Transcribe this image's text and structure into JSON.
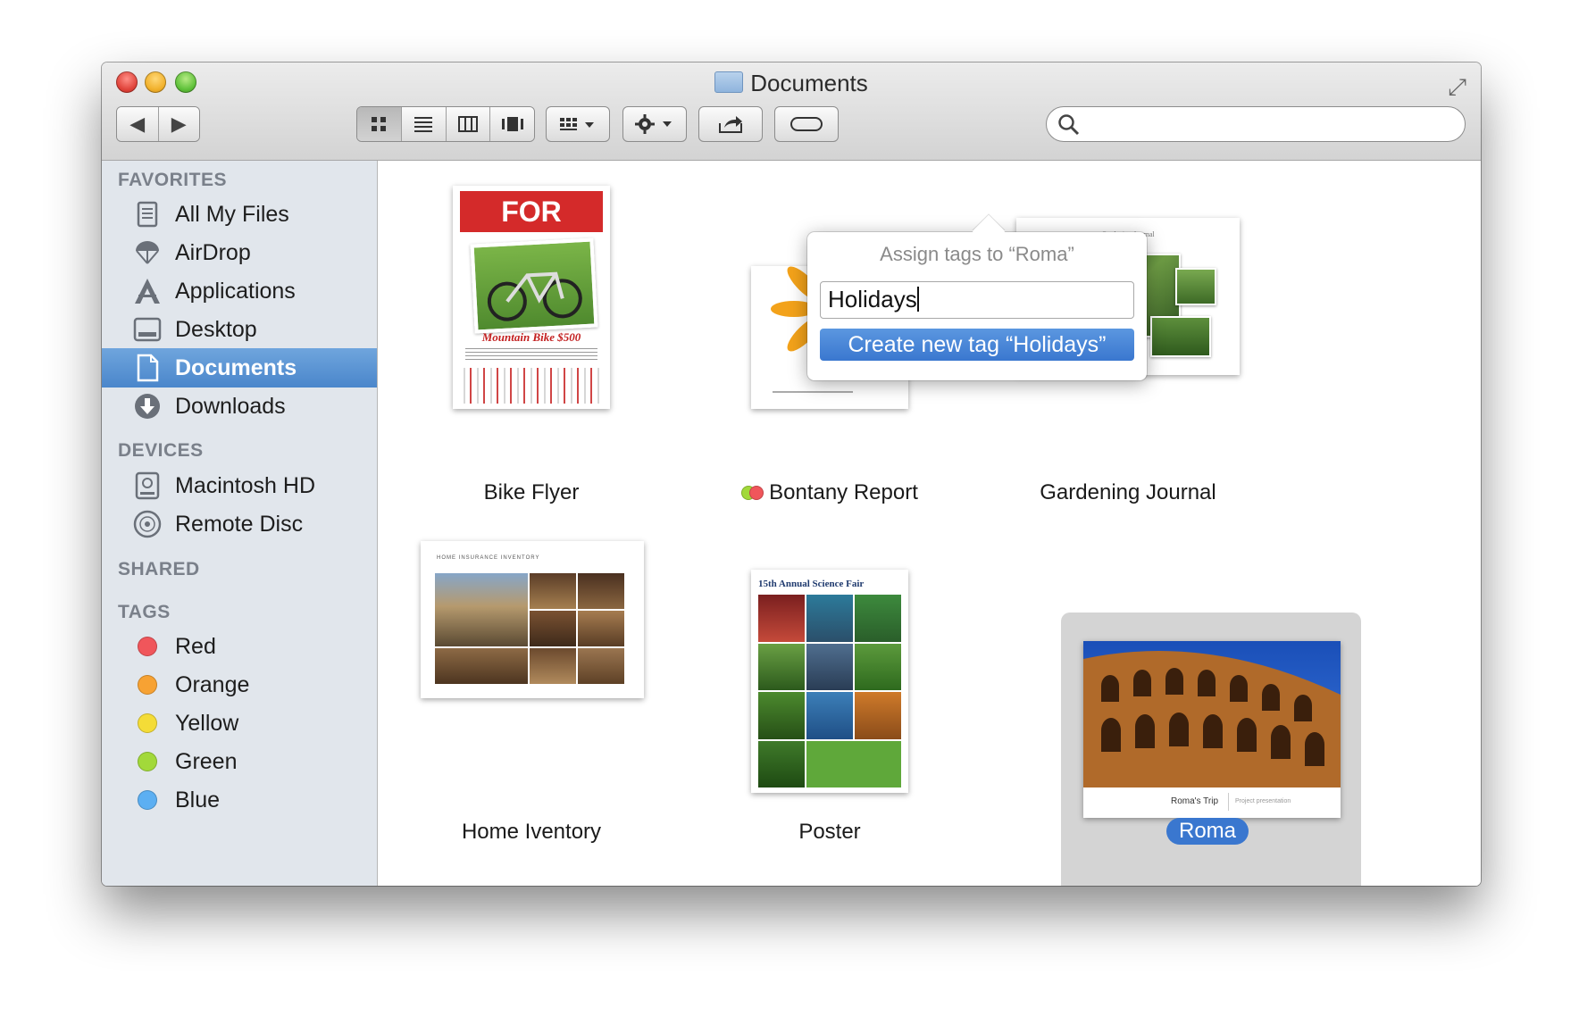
{
  "window": {
    "title": "Documents"
  },
  "toolbar": {
    "back_icon": "chevron-left-icon",
    "forward_icon": "chevron-right-icon",
    "view_icons": [
      "icon-view-icon",
      "list-view-icon",
      "column-view-icon",
      "coverflow-view-icon"
    ],
    "arrange_icon": "arrange-grid-icon",
    "action_icon": "gear-icon",
    "share_icon": "share-icon",
    "tags_icon": "tag-pill-icon",
    "search": {
      "value": "",
      "placeholder": ""
    }
  },
  "sidebar": {
    "favorites_header": "FAVORITES",
    "favorites": [
      {
        "label": "All My Files",
        "icon": "all-files-icon"
      },
      {
        "label": "AirDrop",
        "icon": "airdrop-icon"
      },
      {
        "label": "Applications",
        "icon": "applications-icon"
      },
      {
        "label": "Desktop",
        "icon": "desktop-icon"
      },
      {
        "label": "Documents",
        "icon": "documents-icon",
        "selected": true
      },
      {
        "label": "Downloads",
        "icon": "downloads-icon"
      }
    ],
    "devices_header": "DEVICES",
    "devices": [
      {
        "label": "Macintosh HD",
        "icon": "hard-drive-icon"
      },
      {
        "label": "Remote Disc",
        "icon": "disc-icon"
      }
    ],
    "shared_header": "SHARED",
    "tags_header": "TAGS",
    "tags": [
      {
        "label": "Red",
        "color": "#f0565b"
      },
      {
        "label": "Orange",
        "color": "#f7a233"
      },
      {
        "label": "Yellow",
        "color": "#f4dc37"
      },
      {
        "label": "Green",
        "color": "#a2d93a"
      },
      {
        "label": "Blue",
        "color": "#5caff2"
      }
    ]
  },
  "files": [
    {
      "name": "Bike Flyer",
      "thumb_title": "FOR SALE",
      "thumb_caption": "Mountain Bike $500"
    },
    {
      "name": "Bontany Report",
      "tag_colors": [
        "#a2d93a",
        "#f0565b"
      ]
    },
    {
      "name": "Gardening Journal",
      "thumb_title": "Gardening Journal"
    },
    {
      "name": "Home Iventory",
      "thumb_title": "HOME INSURANCE INVENTORY"
    },
    {
      "name": "Poster",
      "thumb_title": "15th Annual Science Fair"
    },
    {
      "name": "Roma",
      "selected": true,
      "thumb_title": "Roma's Trip",
      "thumb_sub": "Project presentation"
    }
  ],
  "tag_popover": {
    "title": "Assign tags to “Roma”",
    "input_value": "Holidays",
    "create_button": "Create new tag “Holidays”"
  }
}
